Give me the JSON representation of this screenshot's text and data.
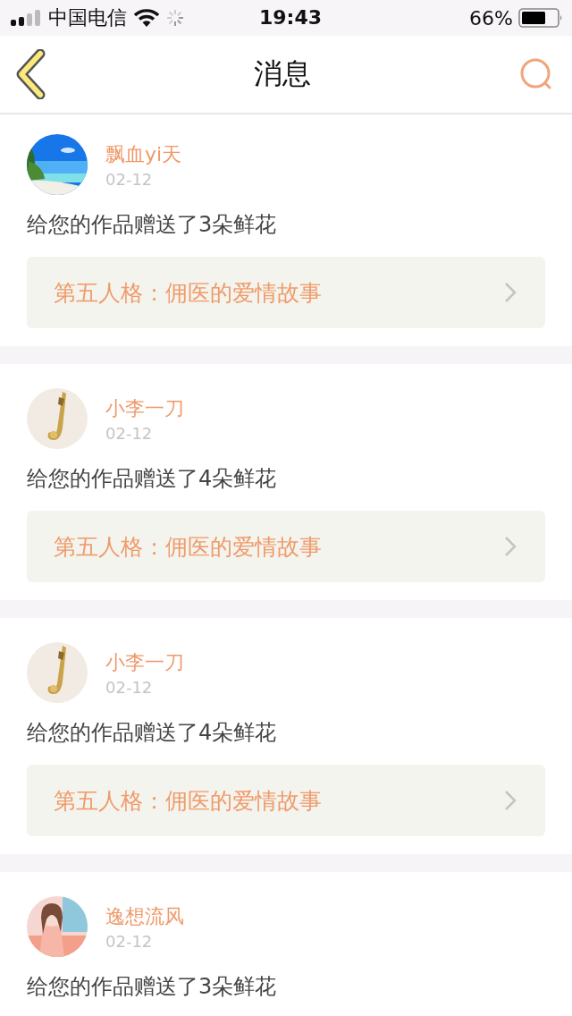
{
  "status_bar": {
    "carrier": "中国电信",
    "time": "19:43",
    "battery": "66%"
  },
  "header": {
    "title": "消息"
  },
  "messages": [
    {
      "name": "飘血yi天",
      "date": "02-12",
      "text": "给您的作品赠送了3朵鲜花",
      "work": "第五人格：佣医的爱情故事"
    },
    {
      "name": "小李一刀",
      "date": "02-12",
      "text": "给您的作品赠送了4朵鲜花",
      "work": "第五人格：佣医的爱情故事"
    },
    {
      "name": "小李一刀",
      "date": "02-12",
      "text": "给您的作品赠送了4朵鲜花",
      "work": "第五人格：佣医的爱情故事"
    },
    {
      "name": "逸想流风",
      "date": "02-12",
      "text": "给您的作品赠送了3朵鲜花"
    }
  ]
}
